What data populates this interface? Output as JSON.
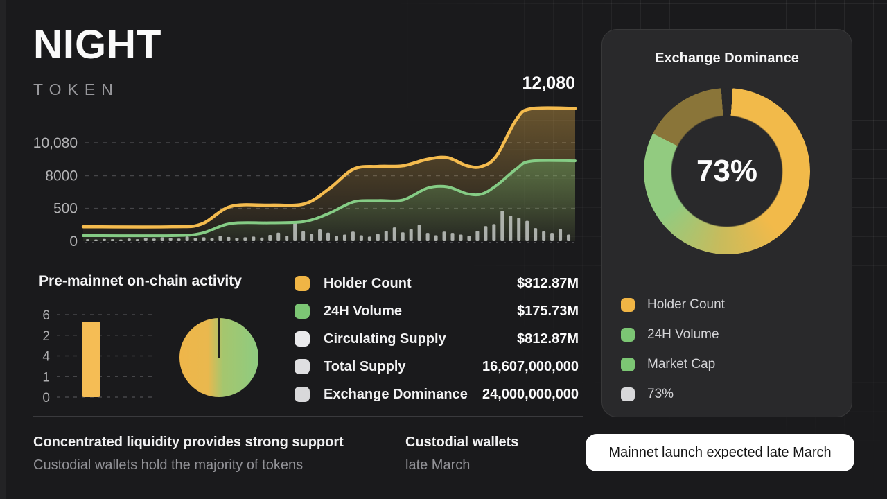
{
  "token": {
    "name": "NIGHT",
    "subtitle": "TOKEN"
  },
  "colors": {
    "accent_yellow": "#f2ba4a",
    "accent_green": "#85cc85",
    "neutral_swatch": "#e3e3e5",
    "background": "#1a1a1c",
    "card_background": "#29292b"
  },
  "chart_data": [
    {
      "id": "token-activity-area",
      "type": "area",
      "grid": "dashed",
      "peak_label": "12,080",
      "y_tick_labels": [
        "10,080",
        "8000",
        "500",
        "0"
      ],
      "y_tick_units": [
        3,
        2,
        1,
        0
      ],
      "series": [
        {
          "name": "Holder Count",
          "color": "#f4bb4e",
          "points": [
            [
              0,
              0.44
            ],
            [
              18,
              0.44
            ],
            [
              24,
              0.52
            ],
            [
              30,
              1.06
            ],
            [
              38,
              1.1
            ],
            [
              45,
              1.14
            ],
            [
              50,
              1.6
            ],
            [
              55,
              2.2
            ],
            [
              60,
              2.28
            ],
            [
              65,
              2.3
            ],
            [
              70,
              2.5
            ],
            [
              74,
              2.55
            ],
            [
              78,
              2.3
            ],
            [
              81,
              2.28
            ],
            [
              84,
              2.6
            ],
            [
              88,
              3.7
            ],
            [
              91,
              4.04
            ],
            [
              100,
              4.05
            ]
          ]
        },
        {
          "name": "24H Volume",
          "color": "#85cc85",
          "points": [
            [
              0,
              0.17
            ],
            [
              18,
              0.17
            ],
            [
              24,
              0.24
            ],
            [
              30,
              0.54
            ],
            [
              38,
              0.56
            ],
            [
              45,
              0.6
            ],
            [
              50,
              0.85
            ],
            [
              55,
              1.2
            ],
            [
              60,
              1.24
            ],
            [
              65,
              1.26
            ],
            [
              70,
              1.62
            ],
            [
              74,
              1.66
            ],
            [
              78,
              1.45
            ],
            [
              81,
              1.44
            ],
            [
              84,
              1.7
            ],
            [
              88,
              2.2
            ],
            [
              91,
              2.44
            ],
            [
              100,
              2.45
            ]
          ]
        }
      ],
      "volume_bars": {
        "color": "#c9cdc9",
        "values": [
          0.06,
          0.05,
          0.07,
          0.06,
          0.05,
          0.08,
          0.06,
          0.1,
          0.08,
          0.12,
          0.1,
          0.08,
          0.14,
          0.1,
          0.12,
          0.09,
          0.16,
          0.13,
          0.1,
          0.12,
          0.14,
          0.11,
          0.19,
          0.26,
          0.17,
          0.57,
          0.3,
          0.22,
          0.36,
          0.26,
          0.16,
          0.2,
          0.29,
          0.18,
          0.14,
          0.22,
          0.31,
          0.42,
          0.27,
          0.37,
          0.5,
          0.25,
          0.18,
          0.29,
          0.25,
          0.2,
          0.16,
          0.31,
          0.46,
          0.52,
          0.93,
          0.78,
          0.72,
          0.62,
          0.4,
          0.3,
          0.25,
          0.37,
          0.2
        ]
      }
    },
    {
      "id": "pre-mainnet-bars",
      "type": "bar",
      "grid": "dashed",
      "y_tick_labels": [
        "6",
        "2",
        "4",
        "1",
        "0"
      ],
      "bar": {
        "color": "#f5bd55",
        "top_unit": 3.66,
        "max_unit": 4
      }
    },
    {
      "id": "activity-pie",
      "type": "pie",
      "slices": [
        {
          "color": "#efb64a",
          "value": 47
        },
        {
          "color": "#8fcb80",
          "value": 53
        }
      ]
    },
    {
      "id": "exchange-dominance-donut",
      "type": "donut",
      "center_label": "73%",
      "gradient_stops": [
        "#29292b 0deg 4deg",
        "#f2ba4a 4deg 140deg",
        "#c8bb5c 185deg",
        "#92cb80 235deg 297deg",
        "#8a7539 297deg 356deg",
        "#29292b 356deg 360deg"
      ]
    }
  ],
  "activity_panel": {
    "title": "Pre-mainnet on-chain activity"
  },
  "stats_legend": {
    "rows": [
      {
        "color": "#f0b545",
        "label": "Holder Count",
        "value": "$812.87M"
      },
      {
        "color": "#7cc674",
        "label": "24H Volume",
        "value": "$175.73M"
      },
      {
        "color": "#eaeaec",
        "label": "Circulating Supply",
        "value": "$812.87M"
      },
      {
        "color": "#dfdfe1",
        "label": "Total Supply",
        "value": "16,607,000,000"
      },
      {
        "color": "#d8d8da",
        "label": "Exchange Dominance",
        "value": "24,000,000,000"
      }
    ]
  },
  "dominance_card": {
    "title": "Exchange Dominance",
    "legend": [
      {
        "color": "#f0b545",
        "label": "Holder Count"
      },
      {
        "color": "#7cc674",
        "label": "24H Volume"
      },
      {
        "color": "#7cc674",
        "label": "Market Cap"
      },
      {
        "color": "#d8d8da",
        "label": "73%"
      }
    ]
  },
  "notes": [
    {
      "title": "Concentrated liquidity provides strong support",
      "subtitle": "Custodial wallets hold the majority of tokens"
    },
    {
      "title": "Custodial wallets",
      "subtitle": "late March"
    }
  ],
  "banner": {
    "label": "Mainnet launch expected late March"
  }
}
